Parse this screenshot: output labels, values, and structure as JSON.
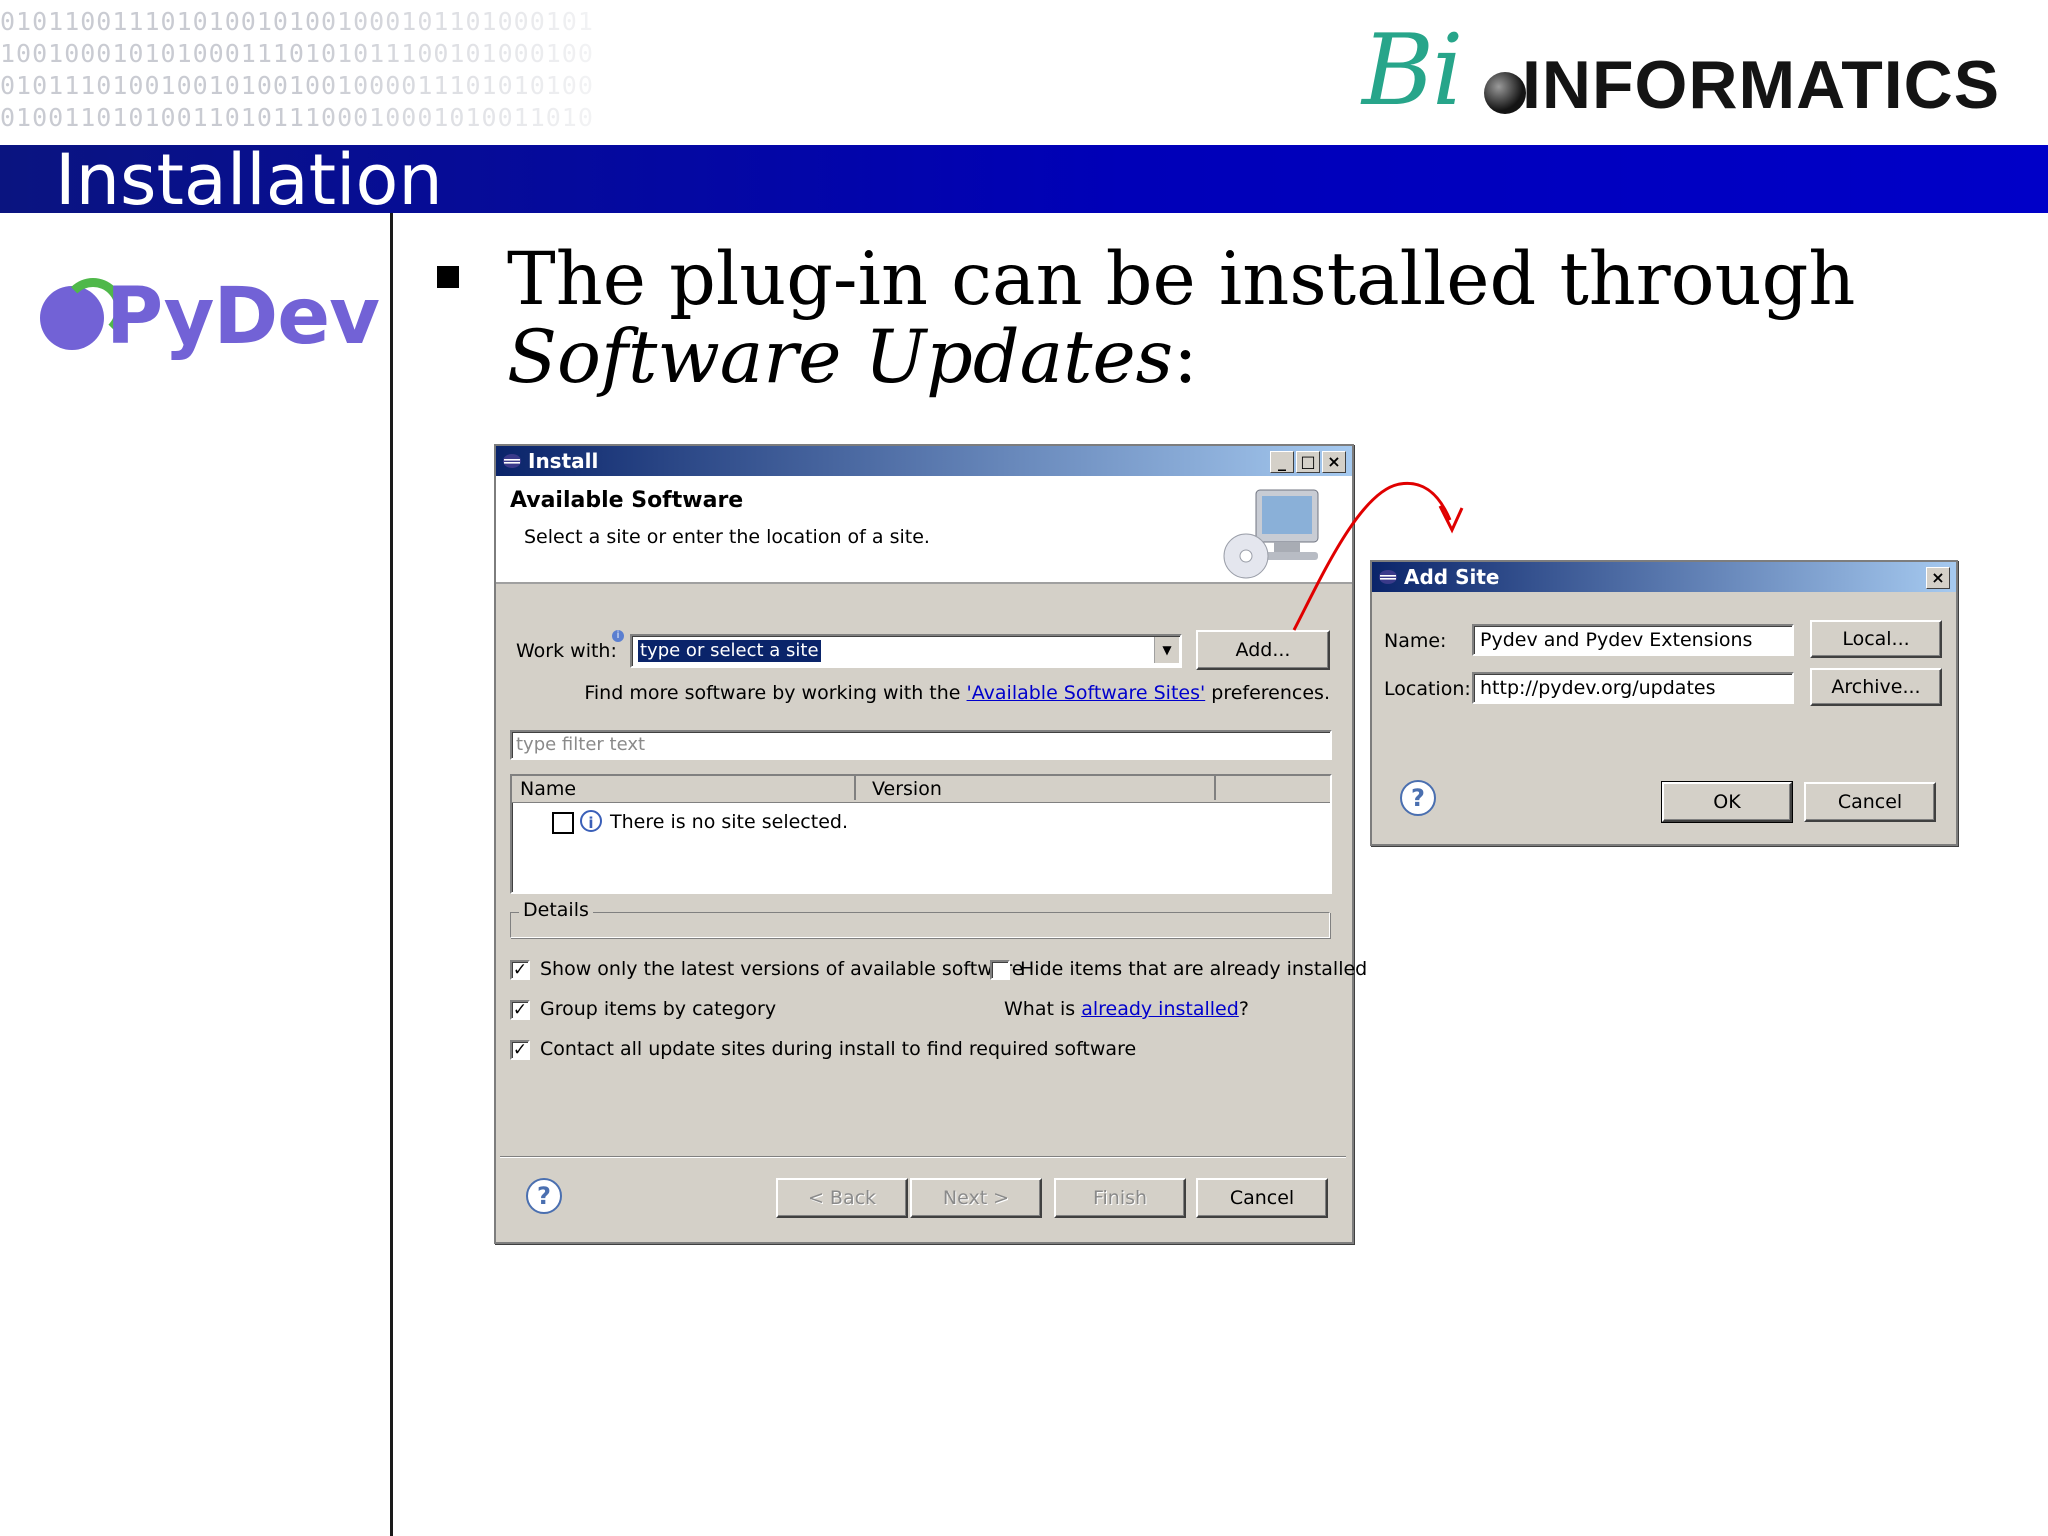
{
  "slide": {
    "binary_lines": [
      "0101100111010100101001000101101000101",
      "1001000101010001110101011100101000100",
      "0101110100100101001001000011101010100",
      "0100110101001101011100010001010011010"
    ],
    "logo_bi": "Bi",
    "logo_text": "INFORMATICS",
    "title": "Installation",
    "pydev_logo": "PyDev",
    "bullet_line1": "The plug-in can be installed through",
    "bullet_line2_italic": "Software Updates",
    "bullet_line2_suffix": ":"
  },
  "install": {
    "title": "Install",
    "heading": "Available Software",
    "subheading": "Select a site or enter the location of a site.",
    "work_with_label": "Work with:",
    "work_with_value": "type or select a site",
    "add_button": "Add...",
    "find_more_prefix": "Find more software by working with the",
    "find_more_link": "'Available Software Sites'",
    "find_more_suffix": "preferences.",
    "filter_placeholder": "type filter text",
    "columns": [
      "Name",
      "Version",
      ""
    ],
    "empty_row": "There is no site selected.",
    "details_label": "Details",
    "opt_latest": "Show only the latest versions of available software",
    "opt_latest_checked": true,
    "opt_hide": "Hide items that are already installed",
    "opt_hide_checked": false,
    "opt_group": "Group items by category",
    "opt_group_checked": true,
    "what_is_prefix": "What is",
    "what_is_link": "already installed",
    "what_is_suffix": "?",
    "opt_contact": "Contact all update sites during install to find required software",
    "opt_contact_checked": true,
    "back_button": "< Back",
    "next_button": "Next >",
    "finish_button": "Finish",
    "cancel_button": "Cancel"
  },
  "add_site": {
    "title": "Add Site",
    "name_label": "Name:",
    "name_value": "Pydev and Pydev Extensions",
    "location_label": "Location:",
    "location_value": "http://pydev.org/updates",
    "local_button": "Local...",
    "archive_button": "Archive...",
    "ok_button": "OK",
    "cancel_button": "Cancel"
  },
  "colors": {
    "title_bar": "#0000b8",
    "logo_green": "#27a58a",
    "pydev_purple": "#7262d6",
    "arrow_red": "#e00000",
    "link_blue": "#0000cc"
  }
}
